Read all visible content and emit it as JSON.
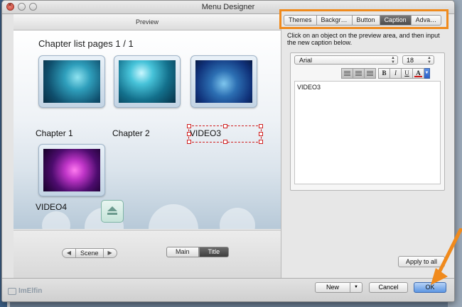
{
  "window": {
    "title": "Menu Designer"
  },
  "preview": {
    "header": "Preview",
    "page_title": "Chapter list pages 1 / 1",
    "chapters": [
      {
        "caption": "Chapter 1",
        "thumbnail": "underwater-cave"
      },
      {
        "caption": "Chapter 2",
        "thumbnail": "underwater-light"
      },
      {
        "caption": "VIDEO3",
        "thumbnail": "fish-school",
        "selected": true
      },
      {
        "caption": "VIDEO4",
        "thumbnail": "pink-jellyfish"
      }
    ],
    "footer": {
      "scene_label": "Scene",
      "main_label": "Main",
      "title_label": "Title",
      "active_view": "Title"
    }
  },
  "right_panel": {
    "tabs": [
      {
        "label": "Themes",
        "active": false
      },
      {
        "label": "Backgr…",
        "active": false
      },
      {
        "label": "Button",
        "active": false
      },
      {
        "label": "Caption",
        "active": true
      },
      {
        "label": "Adva…",
        "active": false
      }
    ],
    "instruction": "Click on an object on the preview area, and then input the new caption below.",
    "font": "Arial",
    "font_size": "18",
    "caption_text": "VIDEO3",
    "format_buttons": {
      "bold": "B",
      "italic": "I",
      "underline": "U",
      "color": "A"
    },
    "apply_all_label": "Apply to all"
  },
  "bottom_bar": {
    "brand": "ImElfin",
    "new_label": "New",
    "cancel_label": "Cancel",
    "ok_label": "OK"
  },
  "colors": {
    "highlight": "#f08a1c",
    "selection": "#d02020",
    "ok_button": "#5d96e3"
  }
}
